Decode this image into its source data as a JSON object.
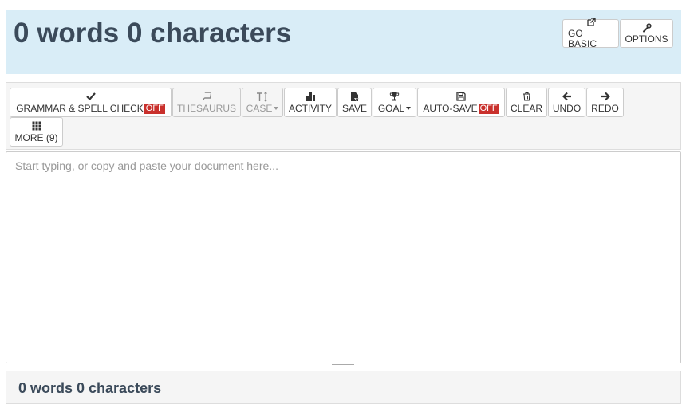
{
  "header": {
    "title": "0 words 0 characters",
    "go_basic": {
      "label": "GO BASIC",
      "icon": "external-link-icon"
    },
    "options": {
      "label": "OPTIONS",
      "icon": "wrench-icon"
    }
  },
  "toolbar": {
    "grammar": {
      "label": "GRAMMAR & SPELL CHECK",
      "badge": "OFF",
      "icon": "check-icon"
    },
    "thesaurus": {
      "label": "THESAURUS",
      "icon": "book-icon"
    },
    "case": {
      "label": "CASE",
      "icon": "text-height-icon"
    },
    "activity": {
      "label": "ACTIVITY",
      "icon": "bar-chart-icon"
    },
    "save": {
      "label": "SAVE",
      "icon": "file-save-icon"
    },
    "goal": {
      "label": "GOAL",
      "icon": "trophy-icon"
    },
    "autosave": {
      "label": "AUTO-SAVE",
      "badge": "OFF",
      "icon": "floppy-disk-icon"
    },
    "clear": {
      "label": "CLEAR",
      "icon": "trash-icon"
    },
    "undo": {
      "label": "UNDO",
      "icon": "arrow-left-icon"
    },
    "redo": {
      "label": "REDO",
      "icon": "arrow-right-icon"
    },
    "more": {
      "label": "MORE (9)",
      "icon": "grid-icon"
    }
  },
  "editor": {
    "placeholder": "Start typing, or copy and paste your document here...",
    "value": ""
  },
  "footer": {
    "count": "0 words 0 characters"
  },
  "colors": {
    "header_bg": "#d9edf7",
    "title": "#3b4a5a",
    "badge": "#c9302c"
  }
}
